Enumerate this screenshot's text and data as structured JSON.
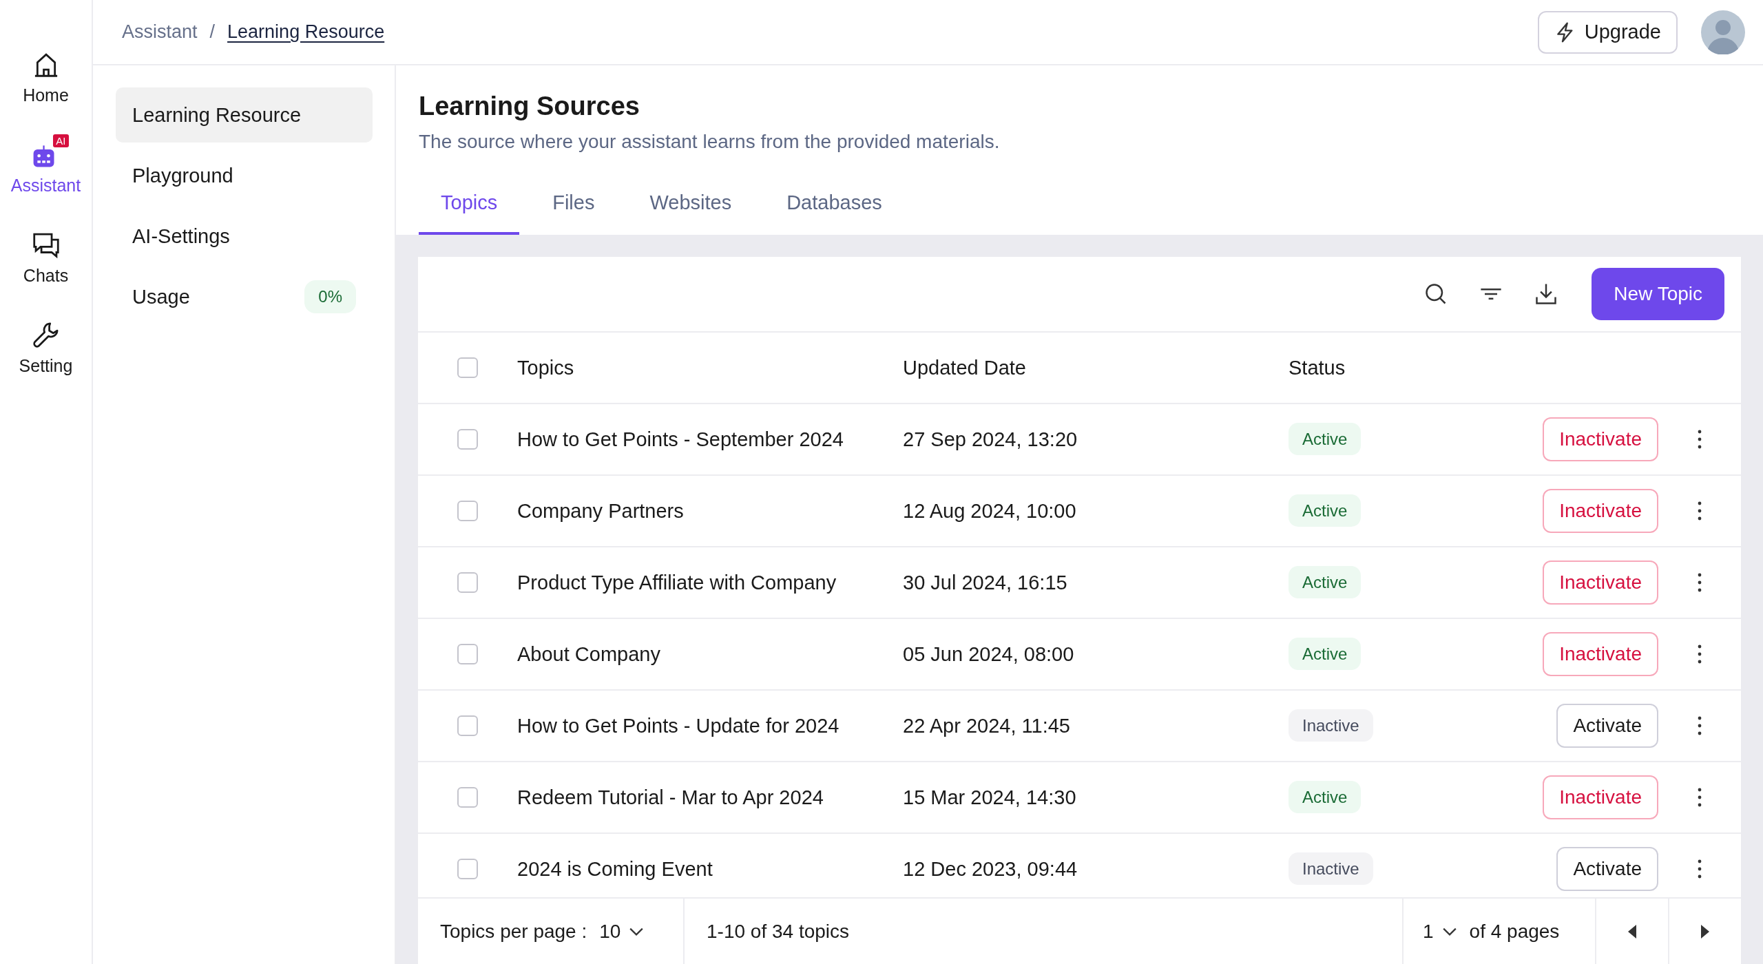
{
  "nav_rail": [
    {
      "kind": "home",
      "label": "Home",
      "selected": false
    },
    {
      "kind": "assistant",
      "label": "Assistant",
      "selected": true,
      "badge": "AI"
    },
    {
      "kind": "chats",
      "label": "Chats",
      "selected": false
    },
    {
      "kind": "setting",
      "label": "Setting",
      "selected": false
    }
  ],
  "breadcrumb": [
    "Assistant",
    "Learning Resource"
  ],
  "breadcrumb_separator": "/",
  "upgrade_button": "Upgrade",
  "sidebar": {
    "items": [
      {
        "label": "Learning Resource",
        "selected": true
      },
      {
        "label": "Playground",
        "selected": false
      },
      {
        "label": "AI-Settings",
        "selected": false
      },
      {
        "label": "Usage",
        "selected": false,
        "badge": "0%"
      }
    ]
  },
  "header": {
    "title": "Learning Sources",
    "subtitle": "The source where your assistant learns from the provided materials."
  },
  "tabs": [
    {
      "label": "Topics",
      "selected": true
    },
    {
      "label": "Files",
      "selected": false
    },
    {
      "label": "Websites",
      "selected": false
    },
    {
      "label": "Databases",
      "selected": false
    }
  ],
  "new_button": "New Topic",
  "table": {
    "header_checked": false,
    "columns": [
      "Topics",
      "Updated Date",
      "Status"
    ],
    "rows": [
      {
        "checked": false,
        "topic": "How to Get Points - September 2024",
        "date": "27 Sep 2024, 13:20",
        "status": "Active",
        "active": true,
        "action": "Inactivate"
      },
      {
        "checked": false,
        "topic": "Company Partners",
        "date": "12 Aug 2024, 10:00",
        "status": "Active",
        "active": true,
        "action": "Inactivate"
      },
      {
        "checked": false,
        "topic": "Product Type Affiliate with Company",
        "date": "30 Jul 2024, 16:15",
        "status": "Active",
        "active": true,
        "action": "Inactivate"
      },
      {
        "checked": false,
        "topic": "About Company",
        "date": "05 Jun 2024, 08:00",
        "status": "Active",
        "active": true,
        "action": "Inactivate"
      },
      {
        "checked": false,
        "topic": "How to Get Points - Update for 2024",
        "date": "22 Apr 2024, 11:45",
        "status": "Inactive",
        "active": false,
        "action": "Activate"
      },
      {
        "checked": false,
        "topic": "Redeem Tutorial - Mar to Apr 2024",
        "date": "15 Mar 2024, 14:30",
        "status": "Active",
        "active": true,
        "action": "Inactivate"
      },
      {
        "checked": false,
        "topic": "2024 is Coming Event",
        "date": "12 Dec 2023, 09:44",
        "status": "Inactive",
        "active": false,
        "action": "Activate"
      }
    ]
  },
  "pagination": {
    "per_page_label": "Topics per page :",
    "per_page": "10",
    "range": "1-10 of 34 topics",
    "page": "1",
    "pages_label": "of 4 pages"
  }
}
